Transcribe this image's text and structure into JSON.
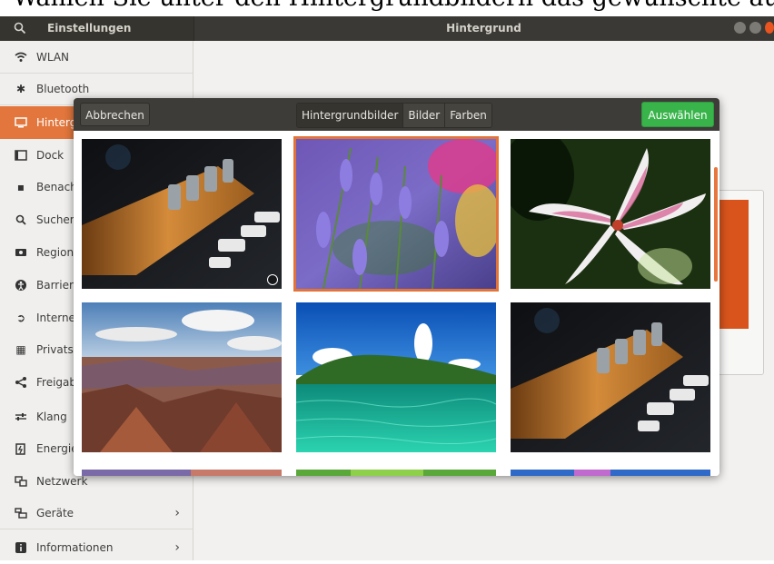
{
  "caption": "Wählen Sie unter den Hintergrundbildern das gewünschte aus.",
  "window": {
    "sidebar_title": "Einstellungen",
    "main_title": "Hintergrund",
    "accent": "#e2763c"
  },
  "sidebar": {
    "items": [
      {
        "label": "WLAN",
        "icon": "wifi-icon"
      },
      {
        "label": "Bluetooth",
        "icon": "bluetooth-icon"
      },
      {
        "label": "Hintergrund",
        "icon": "monitor-icon",
        "selected": true
      },
      {
        "label": "Dock",
        "icon": "dock-icon"
      },
      {
        "label": "Benachrichtigungen",
        "icon": "notification-icon"
      },
      {
        "label": "Suchen",
        "icon": "search-icon"
      },
      {
        "label": "Region und Sprache",
        "icon": "region-icon"
      },
      {
        "label": "Barrierefreiheit",
        "icon": "accessibility-icon"
      },
      {
        "label": "Internetkonten",
        "icon": "online-accounts-icon"
      },
      {
        "label": "Privatsphäre",
        "icon": "privacy-icon"
      },
      {
        "label": "Freigabe",
        "icon": "share-icon"
      },
      {
        "label": "Klang",
        "icon": "sound-icon"
      },
      {
        "label": "Energie",
        "icon": "power-icon"
      },
      {
        "label": "Netzwerk",
        "icon": "network-icon"
      },
      {
        "label": "Geräte",
        "icon": "devices-icon",
        "chevron": true
      },
      {
        "label": "Informationen",
        "icon": "info-icon",
        "chevron": true
      }
    ]
  },
  "dialog": {
    "cancel_label": "Abbrechen",
    "tabs": [
      "Hintergrundbilder",
      "Bilder",
      "Farben"
    ],
    "active_tab": "Hintergrundbilder",
    "select_label": "Auswählen",
    "select_color": "#38b44a",
    "thumbnails": [
      {
        "name": "guitar-photo"
      },
      {
        "name": "lavender-photo",
        "selected": true
      },
      {
        "name": "lily-photo"
      },
      {
        "name": "canyon-photo"
      },
      {
        "name": "island-photo"
      },
      {
        "name": "guitar-photo"
      },
      {
        "name": "sunset-photo"
      },
      {
        "name": "foliage-photo"
      },
      {
        "name": "bluesky-photo"
      }
    ]
  }
}
